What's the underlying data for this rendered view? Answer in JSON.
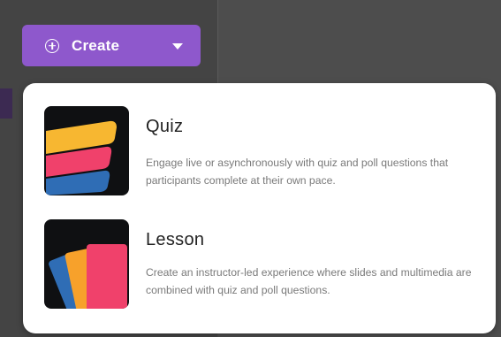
{
  "create_button": {
    "label": "Create",
    "background_color": "#8e58cc",
    "icons": [
      "plus-circle-icon",
      "caret-down-icon"
    ]
  },
  "menu": {
    "items": [
      {
        "title": "Quiz",
        "description": "Engage live or asynchronously with quiz and poll questions that participants complete at their own pace.",
        "icon": "quiz-stack-icon",
        "icon_colors": [
          "#f7b731",
          "#f0416b",
          "#2f6db5"
        ]
      },
      {
        "title": "Lesson",
        "description": "Create an instructor-led experience where slides and multimedia are combined with quiz and poll questions.",
        "icon": "lesson-cards-icon",
        "icon_colors": [
          "#2f6db5",
          "#f7a12b",
          "#f0416b"
        ]
      }
    ]
  }
}
